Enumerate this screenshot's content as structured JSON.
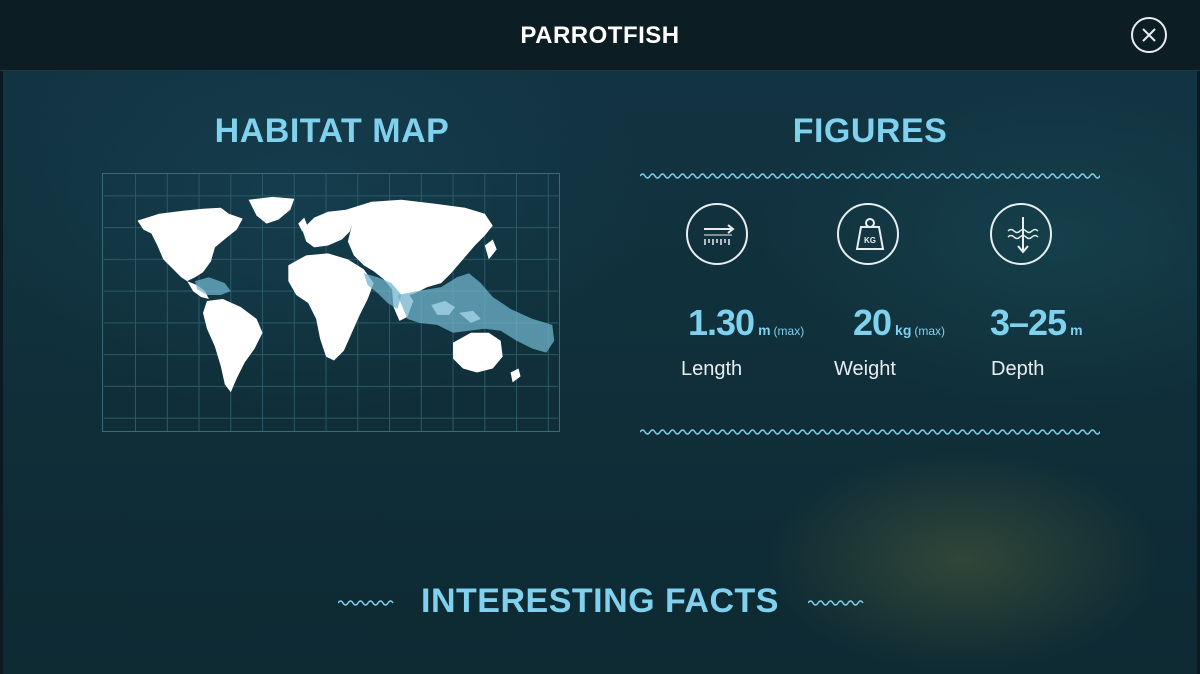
{
  "header": {
    "title": "PARROTFISH",
    "close_icon": "close-icon"
  },
  "habitat": {
    "title": "HABITAT MAP",
    "highlight_color": "#6fb4cc"
  },
  "figures": {
    "title": "FIGURES",
    "items": [
      {
        "icon": "length-ruler-icon",
        "value": "1.30",
        "unit": "m",
        "qualifier": "(max)",
        "label": "Length"
      },
      {
        "icon": "weight-kg-icon",
        "value": "20",
        "unit": "kg",
        "qualifier": "(max)",
        "label": "Weight"
      },
      {
        "icon": "depth-waves-icon",
        "value": "3–25",
        "unit": "m",
        "qualifier": "",
        "label": "Depth"
      }
    ]
  },
  "facts": {
    "title": "INTERESTING FACTS"
  },
  "colors": {
    "accent": "#7fd1ee",
    "header_bg": "#0d1d24",
    "text": "#e8eef0"
  }
}
